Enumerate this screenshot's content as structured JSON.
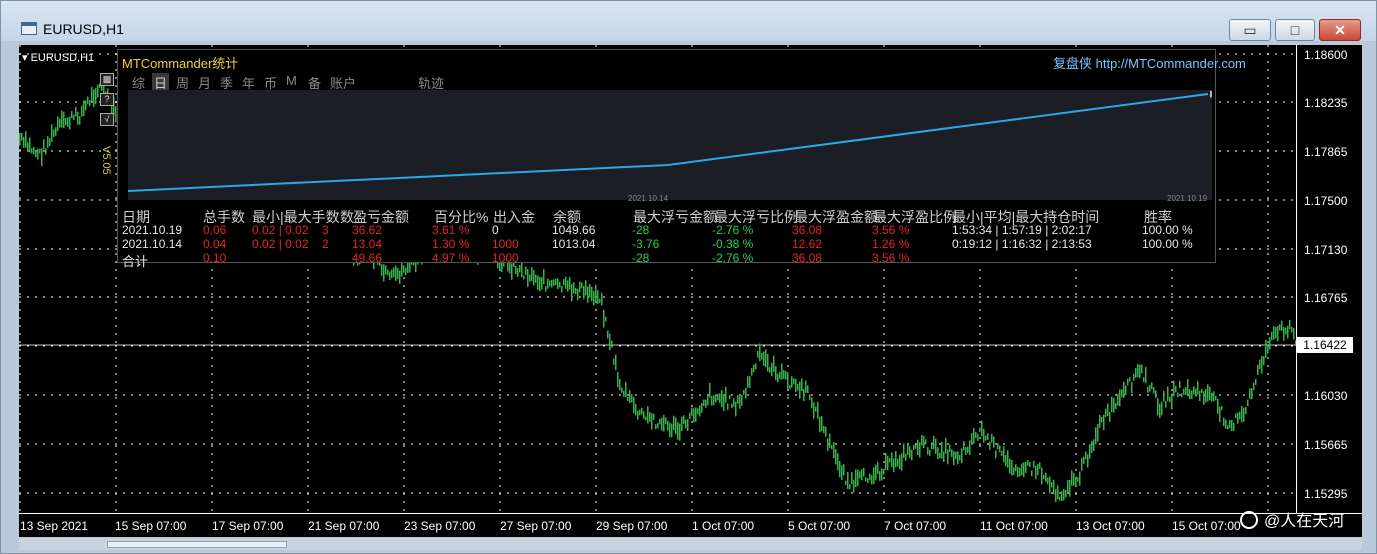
{
  "window": {
    "title": "EURUSD,H1",
    "minimize": "▭",
    "maximize": "□",
    "close": "✕"
  },
  "chart": {
    "symbol": "EURUSD,H1",
    "version": "V5.05",
    "current_price": "1.16422",
    "price_labels": [
      "1.18600",
      "1.18235",
      "1.17865",
      "1.17500",
      "1.17130",
      "1.16765",
      "1.16030",
      "1.15665",
      "1.15295"
    ],
    "time_labels": [
      "13 Sep 2021",
      "15 Sep 07:00",
      "17 Sep 07:00",
      "21 Sep 07:00",
      "23 Sep 07:00",
      "27 Sep 07:00",
      "29 Sep 07:00",
      "1 Oct 07:00",
      "5 Oct 07:00",
      "7 Oct 07:00",
      "11 Oct 07:00",
      "13 Oct 07:00",
      "15 Oct 07:00"
    ],
    "colors": {
      "candles": "#37b24d",
      "grid": "#ffffff",
      "background": "#000000"
    }
  },
  "panel": {
    "title": "MTCommander统计",
    "brand": "复盘侠  http://MTCommander.com",
    "tabs": [
      "综",
      "日",
      "周",
      "月",
      "季",
      "年",
      "币",
      "M",
      "备",
      "账户",
      "轨迹"
    ],
    "active_tab": "日",
    "equity_dates": [
      "2021.10.14",
      "2021.10.19"
    ],
    "equity_color": "#2aa8e8",
    "headers": [
      "日期",
      "总手数",
      "最小|最大手数",
      "数",
      "盈亏金额",
      "百分比%",
      "出入金",
      "余额",
      "最大浮亏金额",
      "最大浮亏比例",
      "最大浮盈金额",
      "最大浮盈比例",
      "最小|平均|最大持仓时间",
      "胜率"
    ],
    "rows": [
      [
        "2021.10.19",
        "0.06",
        "0.02 | 0.02",
        "3",
        "36.62",
        "3.61 %",
        "0",
        "1049.66",
        "-28",
        "-2.76 %",
        "36.08",
        "3.56 %",
        "1:53:34 | 1:57:19 | 2:02:17",
        "100.00 %"
      ],
      [
        "2021.10.14",
        "0.04",
        "0.02 | 0.02",
        "2",
        "13.04",
        "1.30 %",
        "1000",
        "1013.04",
        "-3.76",
        "-0.38 %",
        "12.62",
        "1.26 %",
        "0:19:12 | 1:16:32 | 2:13:53",
        "100.00 %"
      ]
    ],
    "total": {
      "label": "合计",
      "lots": "0.10",
      "pnl": "49.66",
      "pct": "4.97 %",
      "deposit": "1000",
      "max_float_loss": "-28",
      "max_float_loss_pct": "-2.76 %",
      "max_float_profit": "36.08",
      "max_float_profit_pct": "3.56 %"
    }
  },
  "watermark": "@人在天河"
}
